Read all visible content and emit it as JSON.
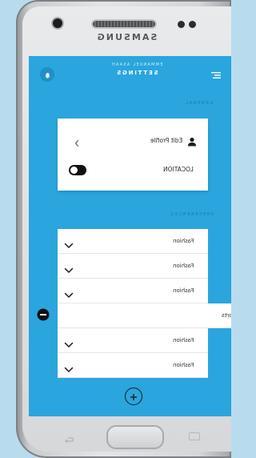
{
  "device": {
    "brand": "SAMSUNG"
  },
  "header": {
    "user": "EMMANUEL ASAAH",
    "title": "SETTINGS"
  },
  "general": {
    "section_label": "GENERAL",
    "edit_profile_label": "Edit Profile",
    "location_label": "LOCATION",
    "location_enabled": true
  },
  "preferences": {
    "section_label": "PREFERENCES",
    "items": [
      {
        "label": "Fashion"
      },
      {
        "label": "Fashion"
      },
      {
        "label": "Fashion"
      },
      {
        "label": "Sports"
      },
      {
        "label": "Fashion"
      },
      {
        "label": "Fashion"
      }
    ]
  },
  "colors": {
    "accent": "#2aa5de",
    "card": "#ffffff"
  },
  "icons": {
    "left_header": "bell-icon",
    "right_header": "menu-icon",
    "edit_profile": "user-icon",
    "back": "chevron-left-icon",
    "row": "chevron-down-icon",
    "remove": "minus-circle-icon",
    "add": "plus-circle-icon"
  }
}
